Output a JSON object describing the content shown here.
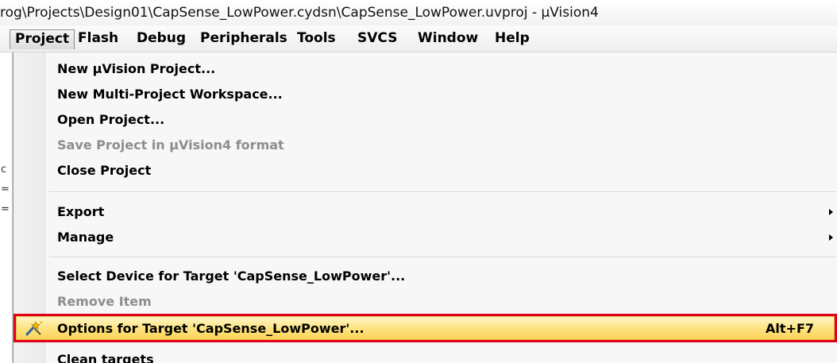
{
  "window": {
    "title": "rog\\Projects\\Design01\\CapSense_LowPower.cydsn\\CapSense_LowPower.uvproj - µVision4"
  },
  "menubar": {
    "items": [
      "Project",
      "Flash",
      "Debug",
      "Peripherals",
      "Tools",
      "SVCS",
      "Window",
      "Help"
    ],
    "open_item": "Project"
  },
  "project_menu": {
    "items": [
      {
        "label": "New µVision Project..."
      },
      {
        "label": "New Multi-Project Workspace..."
      },
      {
        "label": "Open Project..."
      },
      {
        "label": "Save Project in µVision4 format",
        "disabled": true
      },
      {
        "label": "Close Project"
      },
      {
        "label": "Export",
        "submenu": true
      },
      {
        "label": "Manage",
        "submenu": true
      },
      {
        "label": "Select Device for Target 'CapSense_LowPower'..."
      },
      {
        "label": "Remove Item",
        "disabled": true
      },
      {
        "label": "Options for Target 'CapSense_LowPower'...",
        "shortcut": "Alt+F7",
        "highlighted": true,
        "icon": "wand-options-icon"
      },
      {
        "label": "Clean targets"
      }
    ]
  },
  "colors": {
    "highlight_fill": "#fde27d",
    "annotation_outline": "#e0001b",
    "disabled_text": "#8d8d8d"
  }
}
